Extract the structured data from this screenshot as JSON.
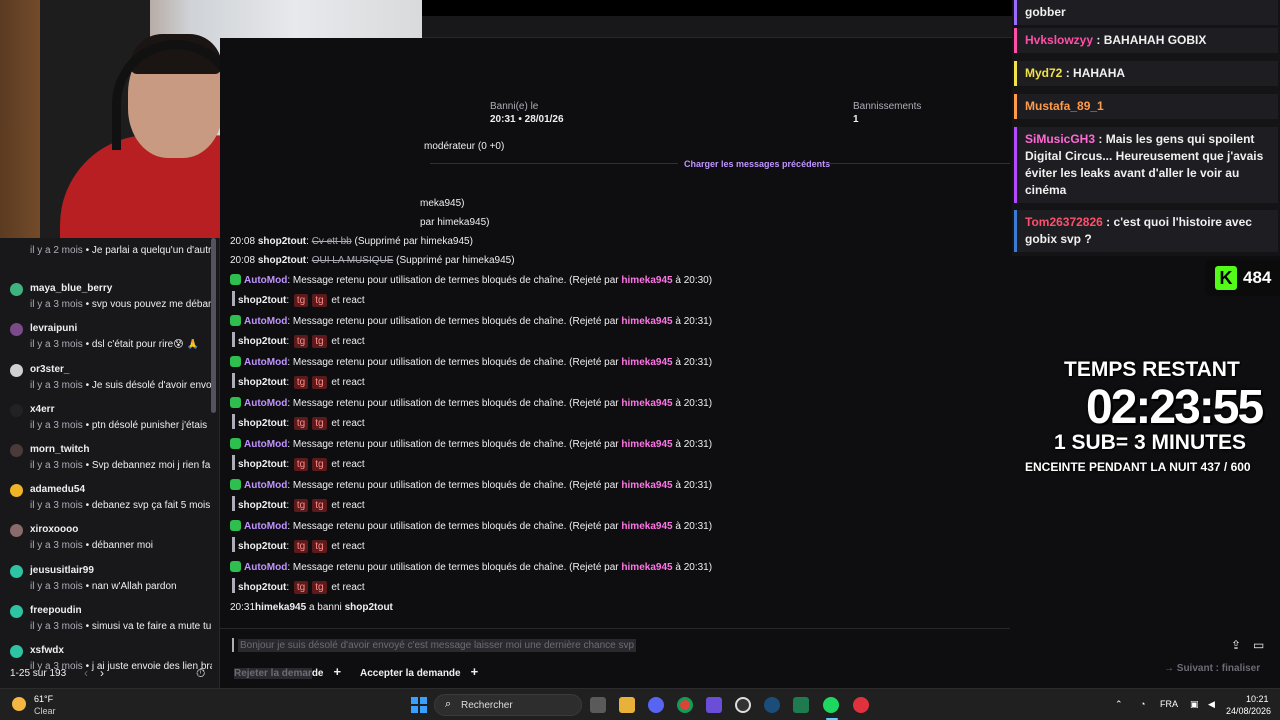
{
  "header": {
    "banned_on_label": "Banni(e) le",
    "banned_on_value": "20:31 • 28/01/26",
    "bans_label": "Bannissements",
    "bans_value": "1",
    "moderator_line": "modérateur (0 +0)",
    "load_previous": "Charger les messages précédents"
  },
  "left_list": {
    "items": [
      {
        "name": "",
        "ago": "il y a 2 mois",
        "msg": "Je parlai a quelqu'un d'autr",
        "color": "#3a3a3d"
      },
      {
        "name": "maya_blue_berry",
        "ago": "il y a 3 mois",
        "msg": "svp vous pouvez me débar",
        "color": "#3fb37f"
      },
      {
        "name": "levraipuni",
        "ago": "il y a 3 mois",
        "msg": "dsl c'était pour rire😰 🙏",
        "color": "#7a4a8a"
      },
      {
        "name": "or3ster_",
        "ago": "il y a 3 mois",
        "msg": "Je suis désolé d'avoir envo",
        "color": "#d0d0d0"
      },
      {
        "name": "x4err",
        "ago": "il y a 3 mois",
        "msg": "ptn désolé punisher j'étais",
        "color": "#222222"
      },
      {
        "name": "morn_twitch",
        "ago": "il y a 3 mois",
        "msg": "Svp debannez moi j rien fa",
        "color": "#4a3a3a"
      },
      {
        "name": "adamedu54",
        "ago": "il y a 3 mois",
        "msg": "debanez svp ça fait 5 mois",
        "color": "#f0b429"
      },
      {
        "name": "xiroxoooo",
        "ago": "il y a 3 mois",
        "msg": "débanner moi",
        "color": "#8a6a6a"
      },
      {
        "name": "jeususitlair99",
        "ago": "il y a 3 mois",
        "msg": "nan w'Allah pardon",
        "color": "#2ec4a3"
      },
      {
        "name": "freepoudin",
        "ago": "il y a 3 mois",
        "msg": "simusi va te faire a mute tu",
        "color": "#2ec4a3"
      },
      {
        "name": "xsfwdx",
        "ago": "il y a 3 mois",
        "msg": "j ai juste envoie des lien bra",
        "color": "#2ec4a3"
      }
    ],
    "pagination": "1-25 sur 193",
    "prev": "‹",
    "next": "›",
    "timer_icon": "timer-icon"
  },
  "messages": {
    "partial1": "meka945)",
    "partial2": "par himeka945)",
    "line1": {
      "time": "20:08",
      "user": "shop2tout",
      "struck": "Cv ett bb",
      "note": "(Supprimé par himeka945)"
    },
    "line2": {
      "time": "20:08",
      "user": "shop2tout",
      "struck": "OUI LA MUSIQUE",
      "note": "(Supprimé par himeka945)"
    },
    "automod_name": "AutoMod",
    "automod_text": ": Message retenu pour utilisation de termes bloqués de chaîne. (Rejeté par ",
    "moderator": "himeka945",
    "at": " à ",
    "times": [
      "20:30",
      "20:31",
      "20:31",
      "20:31",
      "20:31",
      "20:31",
      "20:31",
      "20:31"
    ],
    "quote_user": "shop2tout",
    "quote_colon": ":",
    "tg": "tg",
    "react": "et react",
    "ban_time": "20:31",
    "ban_mod": "himeka945",
    "ban_text": " a banni ",
    "ban_user": "shop2tout"
  },
  "composer": {
    "text": "Bonjour je suis désolé d'avoir envoyé c'est message laisser moi une dernière chance svp",
    "reject_hl": "Rejeter la demar",
    "reject_rest": "de",
    "accept": "Accepter la demande",
    "plus": "+",
    "next_step": "Suivant : finaliser"
  },
  "right_chat": [
    {
      "name": "",
      "text": "gobber",
      "color": "#9b6bff",
      "nameColor": "#fff"
    },
    {
      "name": "Hvkslowzyy",
      "text": "BAHAHAH GOBIX",
      "color": "#ff4fa8",
      "nameColor": "#ff4fa8"
    },
    {
      "name": "Myd72",
      "text": "HAHAHA",
      "color": "#f0e24a",
      "nameColor": "#f0e24a"
    },
    {
      "name": "Mustafa_89_1",
      "text": "",
      "color": "#ff9b4a",
      "nameColor": "#ff9b4a"
    },
    {
      "name": "SiMusicGH3",
      "text": "Mais les gens qui spoilent Digital Circus... Heureusement que j'avais éviter les leaks avant d'aller le voir au cinéma",
      "color": "#b34aff",
      "nameColor": "#ff6ad5"
    },
    {
      "name": "Tom26372826",
      "text": "c'est quoi l'histoire avec gobix svp ?",
      "color": "#3a7bd5",
      "nameColor": "#ff4f6a"
    }
  ],
  "kick": {
    "letter": "K",
    "viewers": "484"
  },
  "timer": {
    "label": "TEMPS RESTANT",
    "value": "02:23:55",
    "rule": "1 SUB= 3 MINUTES",
    "goal": "ENCEINTE PENDANT LA NUIT 437 / 600"
  },
  "taskbar": {
    "temp": "61°F",
    "cond": "Clear",
    "search": "Rechercher",
    "lang": "FRA",
    "time": "10:21",
    "date": "24/08/2026",
    "chevron": "⌃"
  }
}
